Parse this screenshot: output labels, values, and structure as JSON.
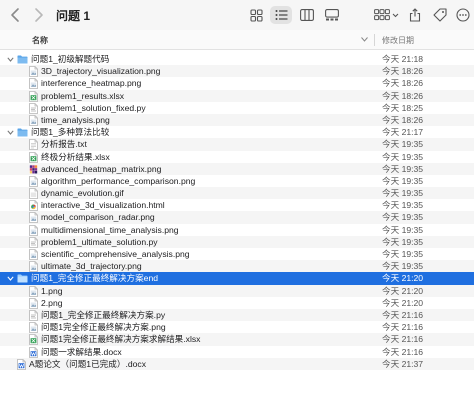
{
  "window": {
    "title": "问题 1"
  },
  "columns": {
    "name": "名称",
    "modified": "修改日期"
  },
  "colors": {
    "selection": "#1f6fe0",
    "folder": "#5aa5e8",
    "stripe": "#f5f5f5"
  },
  "toolbar_icons": [
    "back-icon",
    "forward-icon",
    "icon-view-icon",
    "list-view-icon",
    "column-view-icon",
    "gallery-view-icon",
    "group-icon",
    "share-icon",
    "tag-icon",
    "more-icon"
  ],
  "rows": [
    {
      "kind": "folder",
      "level": 0,
      "expanded": true,
      "name": "问题1_初级解题代码",
      "date": "今天 21:18",
      "icon": "folder-icon"
    },
    {
      "kind": "file",
      "level": 1,
      "name": "3D_trajectory_visualization.png",
      "date": "今天 18:26",
      "icon": "png-file-icon"
    },
    {
      "kind": "file",
      "level": 1,
      "name": "interference_heatmap.png",
      "date": "今天 18:26",
      "icon": "png-file-icon"
    },
    {
      "kind": "file",
      "level": 1,
      "name": "problem1_results.xlsx",
      "date": "今天 18:26",
      "icon": "xlsx-file-icon"
    },
    {
      "kind": "file",
      "level": 1,
      "name": "problem1_solution_fixed.py",
      "date": "今天 18:25",
      "icon": "py-file-icon"
    },
    {
      "kind": "file",
      "level": 1,
      "name": "time_analysis.png",
      "date": "今天 18:26",
      "icon": "png-file-icon"
    },
    {
      "kind": "folder",
      "level": 0,
      "expanded": true,
      "name": "问题1_多种算法比较",
      "date": "今天 21:17",
      "icon": "folder-icon"
    },
    {
      "kind": "file",
      "level": 1,
      "name": "分析报告.txt",
      "date": "今天 19:35",
      "icon": "txt-file-icon"
    },
    {
      "kind": "file",
      "level": 1,
      "name": "终极分析结果.xlsx",
      "date": "今天 19:35",
      "icon": "xlsx-file-icon"
    },
    {
      "kind": "file",
      "level": 1,
      "name": "advanced_heatmap_matrix.png",
      "date": "今天 19:35",
      "icon": "heatmap-file-icon"
    },
    {
      "kind": "file",
      "level": 1,
      "name": "algorithm_performance_comparison.png",
      "date": "今天 19:35",
      "icon": "png-file-icon"
    },
    {
      "kind": "file",
      "level": 1,
      "name": "dynamic_evolution.gif",
      "date": "今天 19:35",
      "icon": "gif-file-icon"
    },
    {
      "kind": "file",
      "level": 1,
      "name": "interactive_3d_visualization.html",
      "date": "今天 19:35",
      "icon": "html-file-icon"
    },
    {
      "kind": "file",
      "level": 1,
      "name": "model_comparison_radar.png",
      "date": "今天 19:35",
      "icon": "png-file-icon"
    },
    {
      "kind": "file",
      "level": 1,
      "name": "multidimensional_time_analysis.png",
      "date": "今天 19:35",
      "icon": "png-file-icon"
    },
    {
      "kind": "file",
      "level": 1,
      "name": "problem1_ultimate_solution.py",
      "date": "今天 19:35",
      "icon": "py-file-icon"
    },
    {
      "kind": "file",
      "level": 1,
      "name": "scientific_comprehensive_analysis.png",
      "date": "今天 19:35",
      "icon": "png-file-icon"
    },
    {
      "kind": "file",
      "level": 1,
      "name": "ultimate_3d_trajectory.png",
      "date": "今天 19:35",
      "icon": "png-file-icon"
    },
    {
      "kind": "folder",
      "level": 0,
      "expanded": true,
      "selected": true,
      "name": "问题1_完全修正最终解决方案end",
      "date": "今天 21:20",
      "icon": "folder-icon"
    },
    {
      "kind": "file",
      "level": 1,
      "name": "1.png",
      "date": "今天 21:20",
      "icon": "png-file-icon"
    },
    {
      "kind": "file",
      "level": 1,
      "name": "2.png",
      "date": "今天 21:20",
      "icon": "png-file-icon"
    },
    {
      "kind": "file",
      "level": 1,
      "name": "问题1_完全修正最终解决方案.py",
      "date": "今天 21:16",
      "icon": "py-file-icon"
    },
    {
      "kind": "file",
      "level": 1,
      "name": "问题1完全修正最终解决方案.png",
      "date": "今天 21:16",
      "icon": "png-file-icon"
    },
    {
      "kind": "file",
      "level": 1,
      "name": "问题1完全修正最终解决方案求解结果.xlsx",
      "date": "今天 21:16",
      "icon": "xlsx-file-icon"
    },
    {
      "kind": "file",
      "level": 1,
      "name": "问题一求解结果.docx",
      "date": "今天 21:16",
      "icon": "docx-file-icon"
    },
    {
      "kind": "file",
      "level": 0,
      "name": "A题论文（问题1已完成）.docx",
      "date": "今天 21:37",
      "icon": "docx-file-icon"
    }
  ]
}
